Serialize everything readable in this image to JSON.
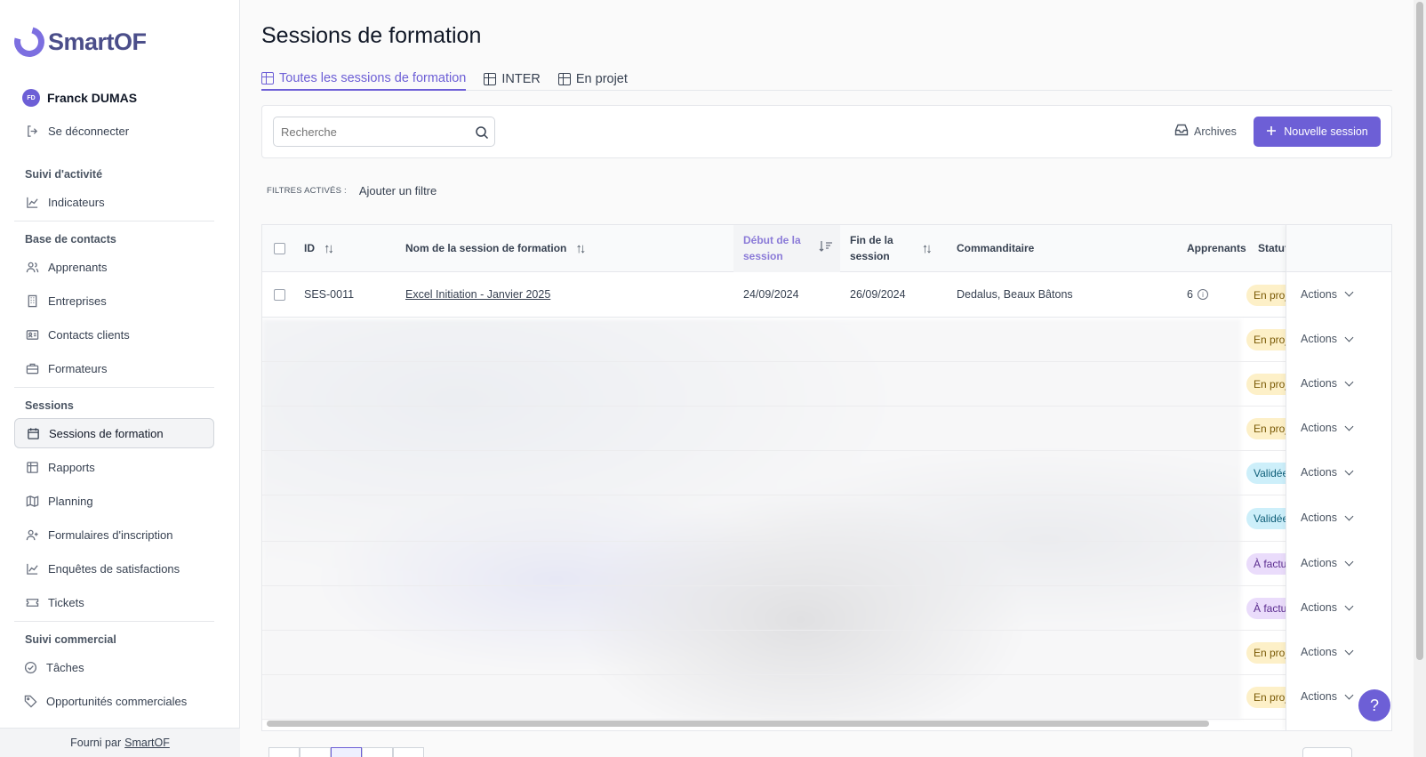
{
  "brand": {
    "name": "SmartOF"
  },
  "user": {
    "initials": "FD",
    "name": "Franck DUMAS",
    "logout": "Se déconnecter"
  },
  "nav": {
    "section_activity": "Suivi d'activité",
    "indicators": "Indicateurs",
    "section_contacts": "Base de contacts",
    "learners": "Apprenants",
    "companies": "Entreprises",
    "client_contacts": "Contacts clients",
    "trainers": "Formateurs",
    "section_sessions": "Sessions",
    "sessions": "Sessions de formation",
    "reports": "Rapports",
    "planning": "Planning",
    "registration_forms": "Formulaires d'inscription",
    "surveys": "Enquêtes de satisfactions",
    "tickets": "Tickets",
    "section_commercial": "Suivi commercial",
    "tasks": "Tâches",
    "opportunities": "Opportunités commerciales"
  },
  "footer": {
    "prefix": "Fourni par",
    "link": "SmartOF"
  },
  "page": {
    "title": "Sessions de formation"
  },
  "tabs": [
    "Toutes les sessions de formation",
    "INTER",
    "En projet"
  ],
  "toolbar": {
    "search_placeholder": "Recherche",
    "archives": "Archives",
    "new_session": "Nouvelle session"
  },
  "filters": {
    "label": "FILTRES ACTIVÉS :",
    "add": "Ajouter un filtre"
  },
  "table": {
    "columns": {
      "id": "ID",
      "name": "Nom de la session de formation",
      "start_1": "Début de la",
      "start_2": "session",
      "end_1": "Fin de la",
      "end_2": "session",
      "client": "Commanditaire",
      "learners": "Apprenants",
      "status": "Statut"
    },
    "first_row": {
      "id": "SES-0011",
      "name": "Excel Initiation - Janvier 2025",
      "start": "24/09/2024",
      "end": "26/09/2024",
      "client": "Dedalus, Beaux Bâtons",
      "learners": "6",
      "status": "En projet"
    },
    "action_label": "Actions",
    "statuses": [
      {
        "label": "En projet",
        "bg": "#fdf0c8",
        "fg": "#7a5a06"
      },
      {
        "label": "En projet",
        "bg": "#fdf0c8",
        "fg": "#7a5a06"
      },
      {
        "label": "En projet",
        "bg": "#fdf0c8",
        "fg": "#7a5a06"
      },
      {
        "label": "En projet",
        "bg": "#fdf0c8",
        "fg": "#7a5a06"
      },
      {
        "label": "Validée",
        "bg": "#cdeffa",
        "fg": "#0e5e78"
      },
      {
        "label": "Validée",
        "bg": "#cdeffa",
        "fg": "#0e5e78"
      },
      {
        "label": "À facturer",
        "bg": "#eadcfb",
        "fg": "#5b2c8f"
      },
      {
        "label": "À facturer",
        "bg": "#eadcfb",
        "fg": "#5b2c8f"
      },
      {
        "label": "En projet",
        "bg": "#fdf0c8",
        "fg": "#7a5a06"
      },
      {
        "label": "En projet",
        "bg": "#fdf0c8",
        "fg": "#7a5a06"
      }
    ]
  },
  "help": {
    "label": "?"
  },
  "colors": {
    "accent": "#6d5fd6"
  }
}
